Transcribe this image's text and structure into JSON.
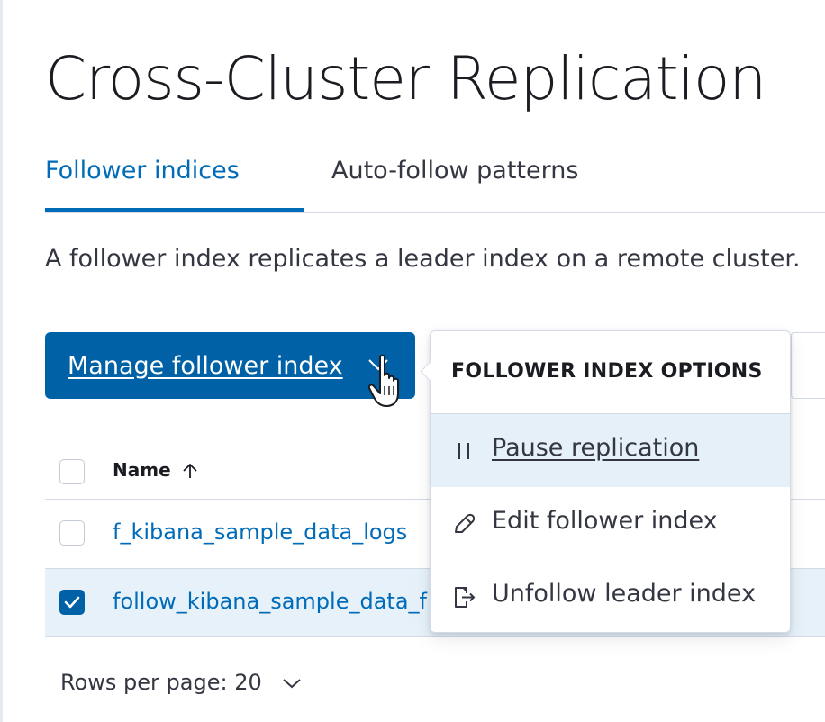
{
  "page": {
    "title": "Cross-Cluster Replication"
  },
  "tabs": [
    {
      "label": "Follower indices",
      "active": true
    },
    {
      "label": "Auto-follow patterns",
      "active": false
    }
  ],
  "description": "A follower index replicates a leader index on a remote cluster.",
  "manage_button": {
    "label": "Manage follower index",
    "icon": "chevron-down-icon"
  },
  "popover": {
    "title": "FOLLOWER INDEX OPTIONS",
    "items": [
      {
        "label": "Pause replication",
        "icon": "pause-icon",
        "highlighted": true
      },
      {
        "label": "Edit follower index",
        "icon": "pencil-icon"
      },
      {
        "label": "Unfollow leader index",
        "icon": "unfollow-icon"
      }
    ]
  },
  "table": {
    "columns": [
      {
        "label": "Name",
        "sort": "ascending"
      }
    ],
    "rows": [
      {
        "name": "f_kibana_sample_data_logs",
        "checked": false
      },
      {
        "name": "follow_kibana_sample_data_f",
        "checked": true
      }
    ]
  },
  "pagination": {
    "rows_per_page": "Rows per page: 20"
  },
  "colors": {
    "primary": "#0061a6",
    "link": "#006bb8",
    "selected_row": "#e6f1fa",
    "highlight": "#e6f0f8"
  }
}
